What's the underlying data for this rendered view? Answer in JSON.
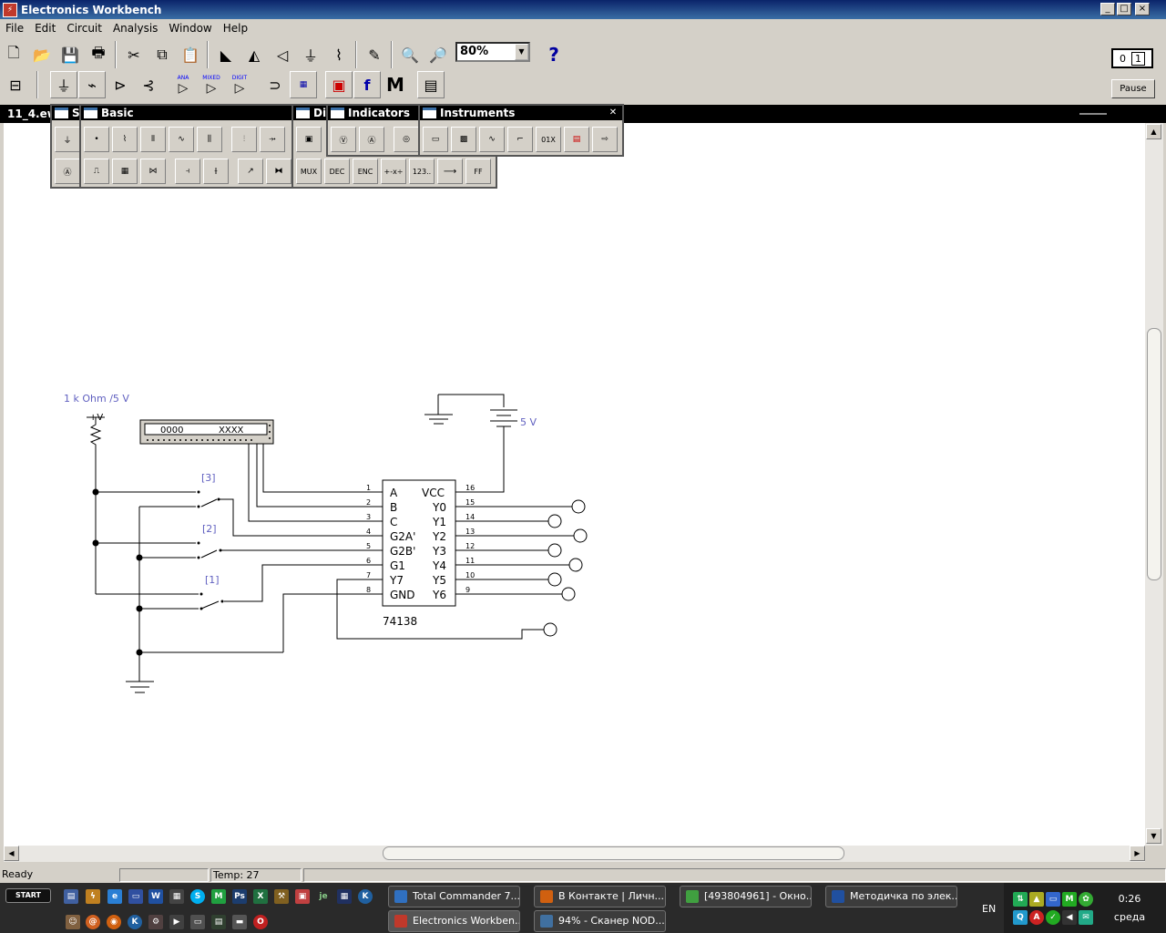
{
  "window": {
    "title": "Electronics Workbench",
    "controls": [
      "_",
      "□",
      "×"
    ]
  },
  "menu": [
    "File",
    "Edit",
    "Circuit",
    "Analysis",
    "Window",
    "Help"
  ],
  "toolbar": {
    "zoom": "80%",
    "help": "?",
    "power_on": "1",
    "power_off": "0",
    "pause": "Pause",
    "labels": {
      "ana": "ANA",
      "mixed": "MIXED",
      "digit": "DIGIT",
      "misc": "M",
      "func": "f"
    }
  },
  "document": {
    "title": "11_4.ewb"
  },
  "palettes": {
    "first_title": "S",
    "basic_title": "Basic",
    "digital_title": "Digital",
    "indicators_title": "Indicators",
    "instruments_title": "Instruments",
    "digital_labels": [
      "MUX",
      "DEC",
      "ENC",
      "+-x÷",
      "123..",
      "⟶",
      "FF"
    ],
    "instrument_labels": [
      "01X"
    ]
  },
  "schematic": {
    "resistor_label": "1 k Ohm /5 V",
    "vplus": "+V",
    "word_gen_left": "0000",
    "word_gen_right": "XXXX",
    "switch_labels": [
      "[3]",
      "[2]",
      "[1]"
    ],
    "battery_label": "5 V",
    "chip_name": "74138",
    "left_pins": [
      {
        "num": "1",
        "name": "A"
      },
      {
        "num": "2",
        "name": "B"
      },
      {
        "num": "3",
        "name": "C"
      },
      {
        "num": "4",
        "name": "G2A'"
      },
      {
        "num": "5",
        "name": "G2B'"
      },
      {
        "num": "6",
        "name": "G1"
      },
      {
        "num": "7",
        "name": "Y7"
      },
      {
        "num": "8",
        "name": "GND"
      }
    ],
    "right_pins": [
      {
        "num": "16",
        "name": "VCC"
      },
      {
        "num": "15",
        "name": "Y0"
      },
      {
        "num": "14",
        "name": "Y1"
      },
      {
        "num": "13",
        "name": "Y2"
      },
      {
        "num": "12",
        "name": "Y3"
      },
      {
        "num": "11",
        "name": "Y4"
      },
      {
        "num": "10",
        "name": "Y5"
      },
      {
        "num": "9",
        "name": "Y6"
      }
    ]
  },
  "status": {
    "text": "Ready",
    "temp": "Temp: 27"
  },
  "taskbar": {
    "start": "START",
    "tasks": [
      "Total Commander 7....",
      "В Контакте | Личн...",
      "[493804961] - Окно...",
      "Методичка по элек...",
      "Electronics Workben...",
      "94% - Сканер NOD..."
    ],
    "lang": "EN",
    "time": "0:26",
    "day": "среда"
  }
}
